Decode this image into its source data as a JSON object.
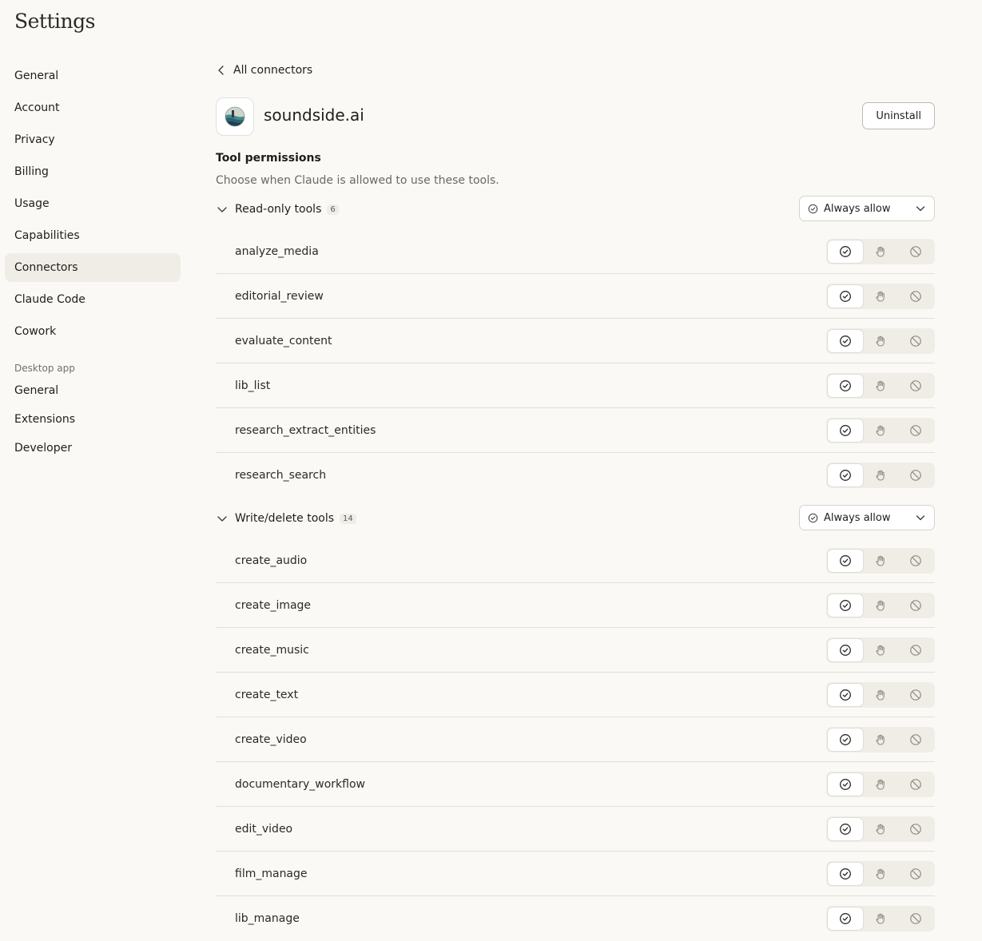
{
  "page": {
    "title": "Settings"
  },
  "sidebar": {
    "items": [
      {
        "label": "General"
      },
      {
        "label": "Account"
      },
      {
        "label": "Privacy"
      },
      {
        "label": "Billing"
      },
      {
        "label": "Usage"
      },
      {
        "label": "Capabilities"
      },
      {
        "label": "Connectors",
        "active": true
      },
      {
        "label": "Claude Code"
      },
      {
        "label": "Cowork"
      }
    ],
    "desktop_section_label": "Desktop app",
    "desktop_items": [
      {
        "label": "General"
      },
      {
        "label": "Extensions"
      },
      {
        "label": "Developer"
      }
    ]
  },
  "connector": {
    "back_label": "All connectors",
    "name": "soundside.ai",
    "uninstall_label": "Uninstall",
    "permissions_title": "Tool permissions",
    "permissions_description": "Choose when Claude is allowed to use these tools."
  },
  "groups": [
    {
      "label": "Read-only tools",
      "count": "6",
      "policy": "Always allow",
      "tools": [
        "analyze_media",
        "editorial_review",
        "evaluate_content",
        "lib_list",
        "research_extract_entities",
        "research_search"
      ]
    },
    {
      "label": "Write/delete tools",
      "count": "14",
      "policy": "Always allow",
      "tools": [
        "create_audio",
        "create_image",
        "create_music",
        "create_text",
        "create_video",
        "documentary_workflow",
        "edit_video",
        "film_manage",
        "lib_manage"
      ]
    }
  ],
  "icons": {
    "back": "chevron-left-icon",
    "collapse": "chevron-down-icon",
    "allow": "check-circle-icon",
    "ask": "hand-icon",
    "block": "block-icon"
  },
  "colors": {
    "background": "#faf9f5",
    "active_nav": "#efede6",
    "segment_bg": "#efede6",
    "text": "#1f1e1d",
    "muted": "#6b6964"
  }
}
